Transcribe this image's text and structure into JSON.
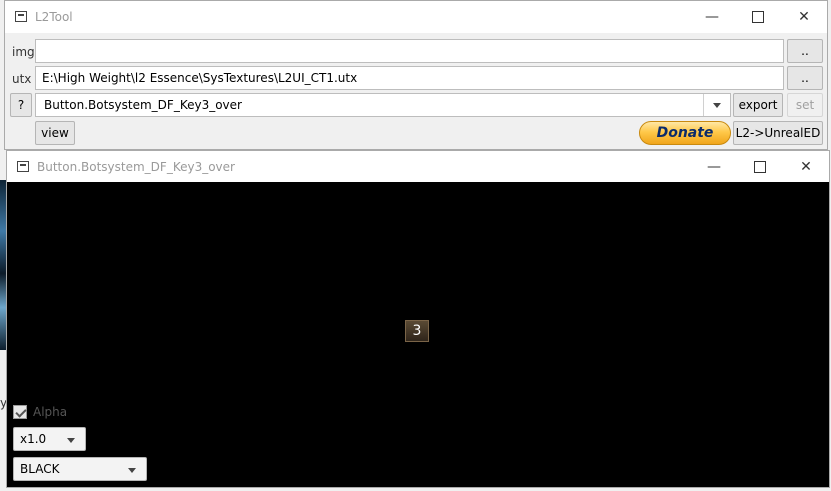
{
  "main_window": {
    "title": "L2Tool",
    "img_label": "img",
    "img_value": "",
    "img_browse": "..",
    "utx_label": "utx",
    "utx_value": "E:\\High Weight\\l2 Essence\\SysTextures\\L2UI_CT1.utx",
    "utx_browse": "..",
    "help_button": "?",
    "texture_select": "Button.Botsystem_DF_Key3_over",
    "export_button": "export",
    "set_button": "set",
    "view_button": "view",
    "donate_button": "Donate",
    "unrealed_button": "L2->UnrealED"
  },
  "viewer_window": {
    "title": "Button.Botsystem_DF_Key3_over",
    "preview_glyph": "3",
    "alpha_label": "Alpha",
    "alpha_checked": true,
    "zoom_select": "x1.0",
    "bg_select": "BLACK"
  },
  "window_controls": {
    "minimize": "—",
    "close": "✕"
  },
  "colors": {
    "canvas_bg": "#000000",
    "donate_text": "#0b2b6b",
    "donate_gold": "#ffc94a"
  },
  "desktop_fragment": "y"
}
